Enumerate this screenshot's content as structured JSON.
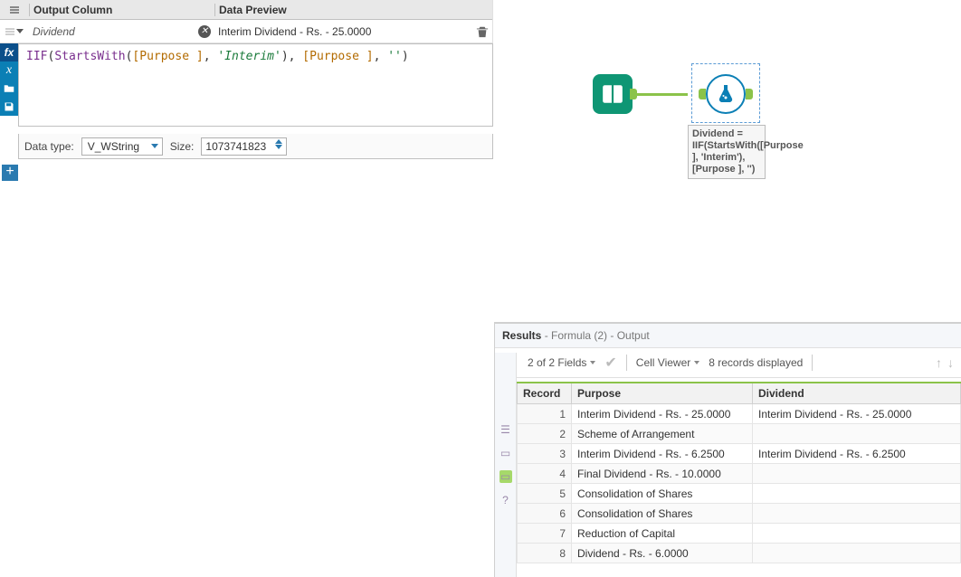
{
  "config": {
    "headers": {
      "output": "Output Column",
      "preview": "Data Preview"
    },
    "column_name": "Dividend",
    "preview_value": "Interim Dividend - Rs. - 25.0000",
    "expression_html": "<span class='tok-fn'>IIF</span>(<span class='tok-fn'>StartsWith</span>(<span class='tok-col'>[Purpose ]</span>, <span class='tok-str'>'Interim'</span>), <span class='tok-col'>[Purpose ]</span>, <span class='tok-str'>''</span>)",
    "datatype_label": "Data type:",
    "datatype_value": "V_WString",
    "size_label": "Size:",
    "size_value": "1073741823"
  },
  "canvas": {
    "node_label": "Dividend = IIF(StartsWith([Purpose ], 'Interim'), [Purpose ], '')"
  },
  "results": {
    "title_prefix": "Results",
    "title_suffix": "- Formula (2) - Output",
    "fields_summary": "2 of 2 Fields",
    "cell_viewer": "Cell Viewer",
    "records_summary": "8 records displayed",
    "cols": {
      "record": "Record",
      "purpose": "Purpose",
      "dividend": "Dividend"
    },
    "rows": [
      {
        "n": "1",
        "purpose": "Interim Dividend - Rs. - 25.0000",
        "dividend": "Interim Dividend - Rs. - 25.0000"
      },
      {
        "n": "2",
        "purpose": "Scheme of Arrangement",
        "dividend": ""
      },
      {
        "n": "3",
        "purpose": "Interim Dividend - Rs. - 6.2500",
        "dividend": "Interim Dividend - Rs. - 6.2500"
      },
      {
        "n": "4",
        "purpose": "Final Dividend - Rs. - 10.0000",
        "dividend": ""
      },
      {
        "n": "5",
        "purpose": "Consolidation of Shares",
        "dividend": ""
      },
      {
        "n": "6",
        "purpose": "Consolidation of Shares",
        "dividend": ""
      },
      {
        "n": "7",
        "purpose": "Reduction of Capital",
        "dividend": ""
      },
      {
        "n": "8",
        "purpose": "Dividend - Rs. - 6.0000",
        "dividend": ""
      }
    ]
  }
}
